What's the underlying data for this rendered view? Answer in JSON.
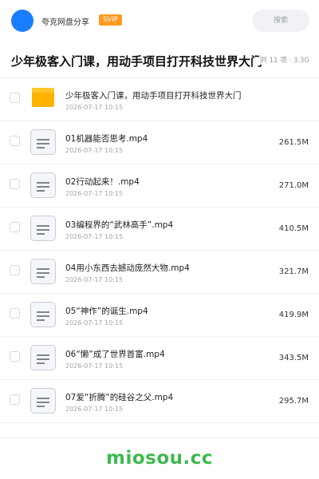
{
  "header": {
    "share_name": "夸克网盘分享",
    "badge": "SVIP",
    "search_placeholder": "搜索"
  },
  "folder": {
    "title": "少年极客入门课，用动手项目打开科技世界大门",
    "summary": "共 11 项 · 3.3G"
  },
  "items": [
    {
      "name": "少年极客入门课，用动手项目打开科技世界大门",
      "date": "2026-07-17 10:15",
      "size": "",
      "type": "folder",
      "icon": "folder-icon"
    },
    {
      "name": "01机器能否思考.mp4",
      "date": "2026-07-17 10:15",
      "size": "261.5M",
      "type": "file",
      "icon": "video-file-icon"
    },
    {
      "name": "02行动起来！.mp4",
      "date": "2026-07-17 10:15",
      "size": "271.0M",
      "type": "file",
      "icon": "video-file-icon"
    },
    {
      "name": "03编程界的“武林高手”.mp4",
      "date": "2026-07-17 10:15",
      "size": "410.5M",
      "type": "file",
      "icon": "video-file-icon"
    },
    {
      "name": "04用小东西去撼动庞然大物.mp4",
      "date": "2026-07-17 10:15",
      "size": "321.7M",
      "type": "file",
      "icon": "video-file-icon"
    },
    {
      "name": "05“神作”的诞生.mp4",
      "date": "2026-07-17 10:15",
      "size": "419.9M",
      "type": "file",
      "icon": "video-file-icon"
    },
    {
      "name": "06“懒”成了世界首富.mp4",
      "date": "2026-07-17 10:15",
      "size": "343.5M",
      "type": "file",
      "icon": "video-file-icon"
    },
    {
      "name": "07爱“折腾”的硅谷之父.mp4",
      "date": "2026-07-17 10:15",
      "size": "295.7M",
      "type": "file",
      "icon": "video-file-icon"
    }
  ],
  "footer": {
    "watermark": "miosou.cc"
  },
  "colors": {
    "avatar": "#1a7dff",
    "badge": "#ff9a1f",
    "folder": "#ffb300",
    "watermark": "#3fb950"
  }
}
